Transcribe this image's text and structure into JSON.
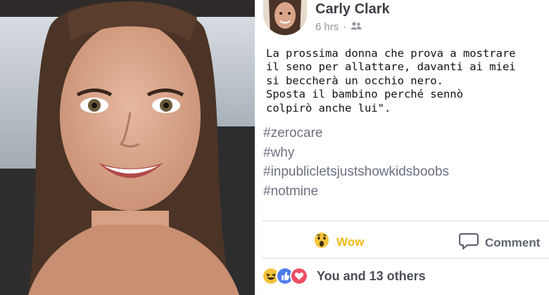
{
  "post": {
    "author": "Carly Clark",
    "time": "6 hrs",
    "separator": "·",
    "body": "La prossima donna che prova a mostrare\nil seno per allattare, davanti ai miei\nsi beccherà un occhio nero.\nSposta il bambino perché sennò\ncolpirò anche lui\".",
    "hashtags": [
      "#zerocare",
      "#why",
      "#inpublicletsjustshowkidsboobs",
      "#notmine"
    ],
    "reaction_button": "Wow",
    "comment_button": "Comment",
    "reaction_summary": "You and 13 others"
  },
  "icons": {
    "privacy": "friends-icon",
    "reaction": "wow-emoji-icon",
    "comment": "comment-icon",
    "summary_reactions": [
      "haha-icon",
      "like-icon",
      "love-icon"
    ]
  },
  "colors": {
    "wow": "#f0ba15",
    "like": "#4b7bec",
    "love": "#ef4d67",
    "hashtag": "#6d7180"
  }
}
